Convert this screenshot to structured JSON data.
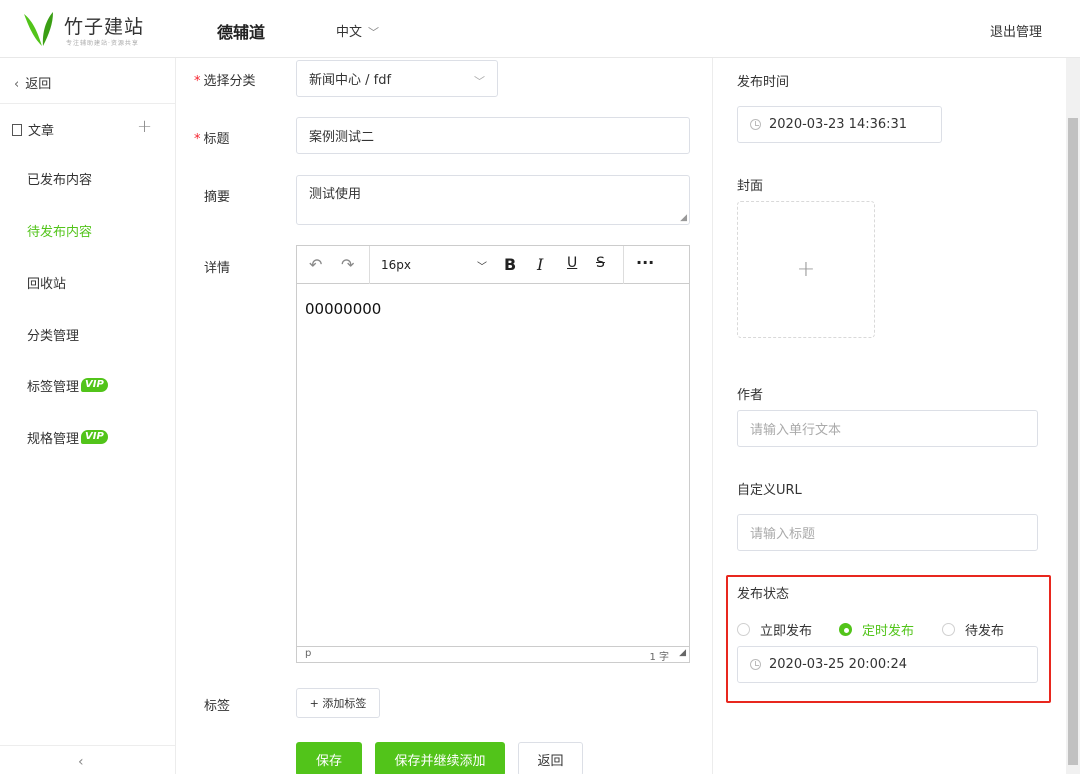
{
  "header": {
    "brand": "竹子建站",
    "brand_sub": "专注辅助建站·资源共享",
    "site_name": "德辅道",
    "language": "中文",
    "logout": "退出管理"
  },
  "sidebar": {
    "back": "返回",
    "section": "文章",
    "items": [
      {
        "label": "已发布内容",
        "active": false
      },
      {
        "label": "待发布内容",
        "active": true
      },
      {
        "label": "回收站",
        "active": false
      },
      {
        "label": "分类管理",
        "active": false
      },
      {
        "label": "标签管理",
        "active": false,
        "badge": "VIP"
      },
      {
        "label": "规格管理",
        "active": false,
        "badge": "VIP"
      }
    ],
    "collapse": "‹"
  },
  "form": {
    "category_label": "选择分类",
    "category_value": "新闻中心 / fdf",
    "title_label": "标题",
    "title_value": "案例测试二",
    "summary_label": "摘要",
    "summary_value": "测试使用",
    "detail_label": "详情",
    "editor": {
      "font_size": "16px",
      "content": "00000000",
      "status_tag": "p",
      "word_count": "1 字"
    },
    "tags_label": "标签",
    "add_tag": "+ 添加标签",
    "save": "保存",
    "save_continue": "保存并继续添加",
    "back": "返回"
  },
  "right": {
    "publish_time_label": "发布时间",
    "publish_time_value": "2020-03-23 14:36:31",
    "cover_label": "封面",
    "cover_add": "+",
    "author_label": "作者",
    "author_placeholder": "请输入单行文本",
    "url_label": "自定义URL",
    "url_placeholder": "请输入标题",
    "status_label": "发布状态",
    "status_options": [
      {
        "label": "立即发布",
        "selected": false
      },
      {
        "label": "定时发布",
        "selected": true
      },
      {
        "label": "待发布",
        "selected": false
      }
    ],
    "scheduled_time": "2020-03-25 20:00:24"
  },
  "colors": {
    "accent": "#52c41a",
    "highlight_border": "#e8271e"
  }
}
